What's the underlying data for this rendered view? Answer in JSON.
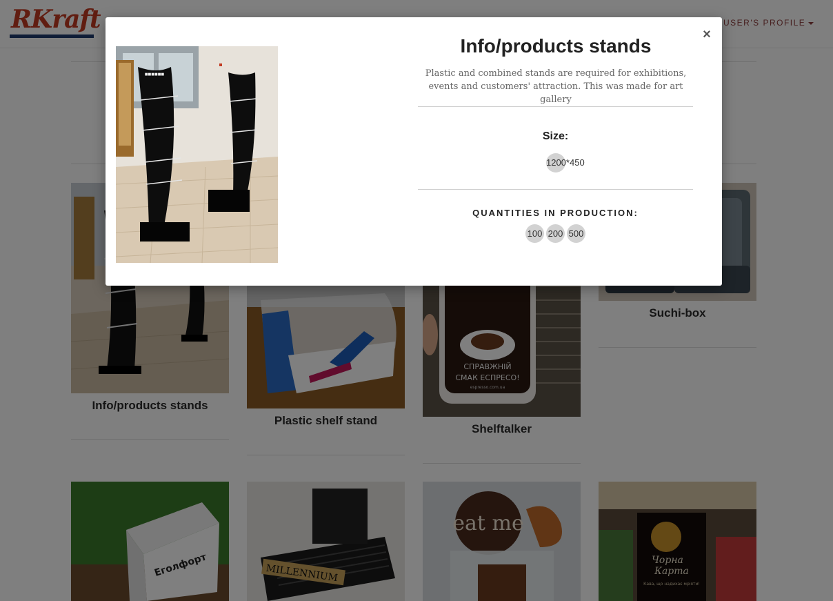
{
  "header": {
    "logo_text": "RKraft",
    "profile_label": "USER'S PROFILE"
  },
  "products": [
    {
      "title": "Info/products stands"
    },
    {
      "title": "Plastic shelf stand"
    },
    {
      "title": "Shelftalker"
    },
    {
      "title": "Suchi-box"
    }
  ],
  "photo_texts": {
    "shelftalker_line1": "СПРАВЖНІЙ",
    "shelftalker_line2": "СМАК ЕСПРЕСО!",
    "shelftalker_site": "espresso.com.ua",
    "box_brand": "Еголфорт",
    "tray_label": "MILLENNIUM",
    "eatme_label": "eat me",
    "karta_line1": "Чорна",
    "karta_line2": "Карта",
    "karta_slogan": "Кава, що надихає мріяти!"
  },
  "modal": {
    "title": "Info/products stands",
    "description": "Plastic and combined stands are required for exhibitions, events and customers' attraction. This was made for art gallery",
    "size_label": "Size:",
    "size_value": "1200*450",
    "quantities_label": "QUANTITIES IN PRODUCTION:",
    "quantities": [
      "100",
      "200",
      "500"
    ],
    "close_symbol": "×"
  },
  "colors": {
    "logo_red": "#c23b22",
    "logo_blue": "#1f3a6e",
    "profile": "#8c3c3c",
    "chip": "#d2d2d2",
    "overlay": "rgba(0,0,0,0.5)"
  }
}
